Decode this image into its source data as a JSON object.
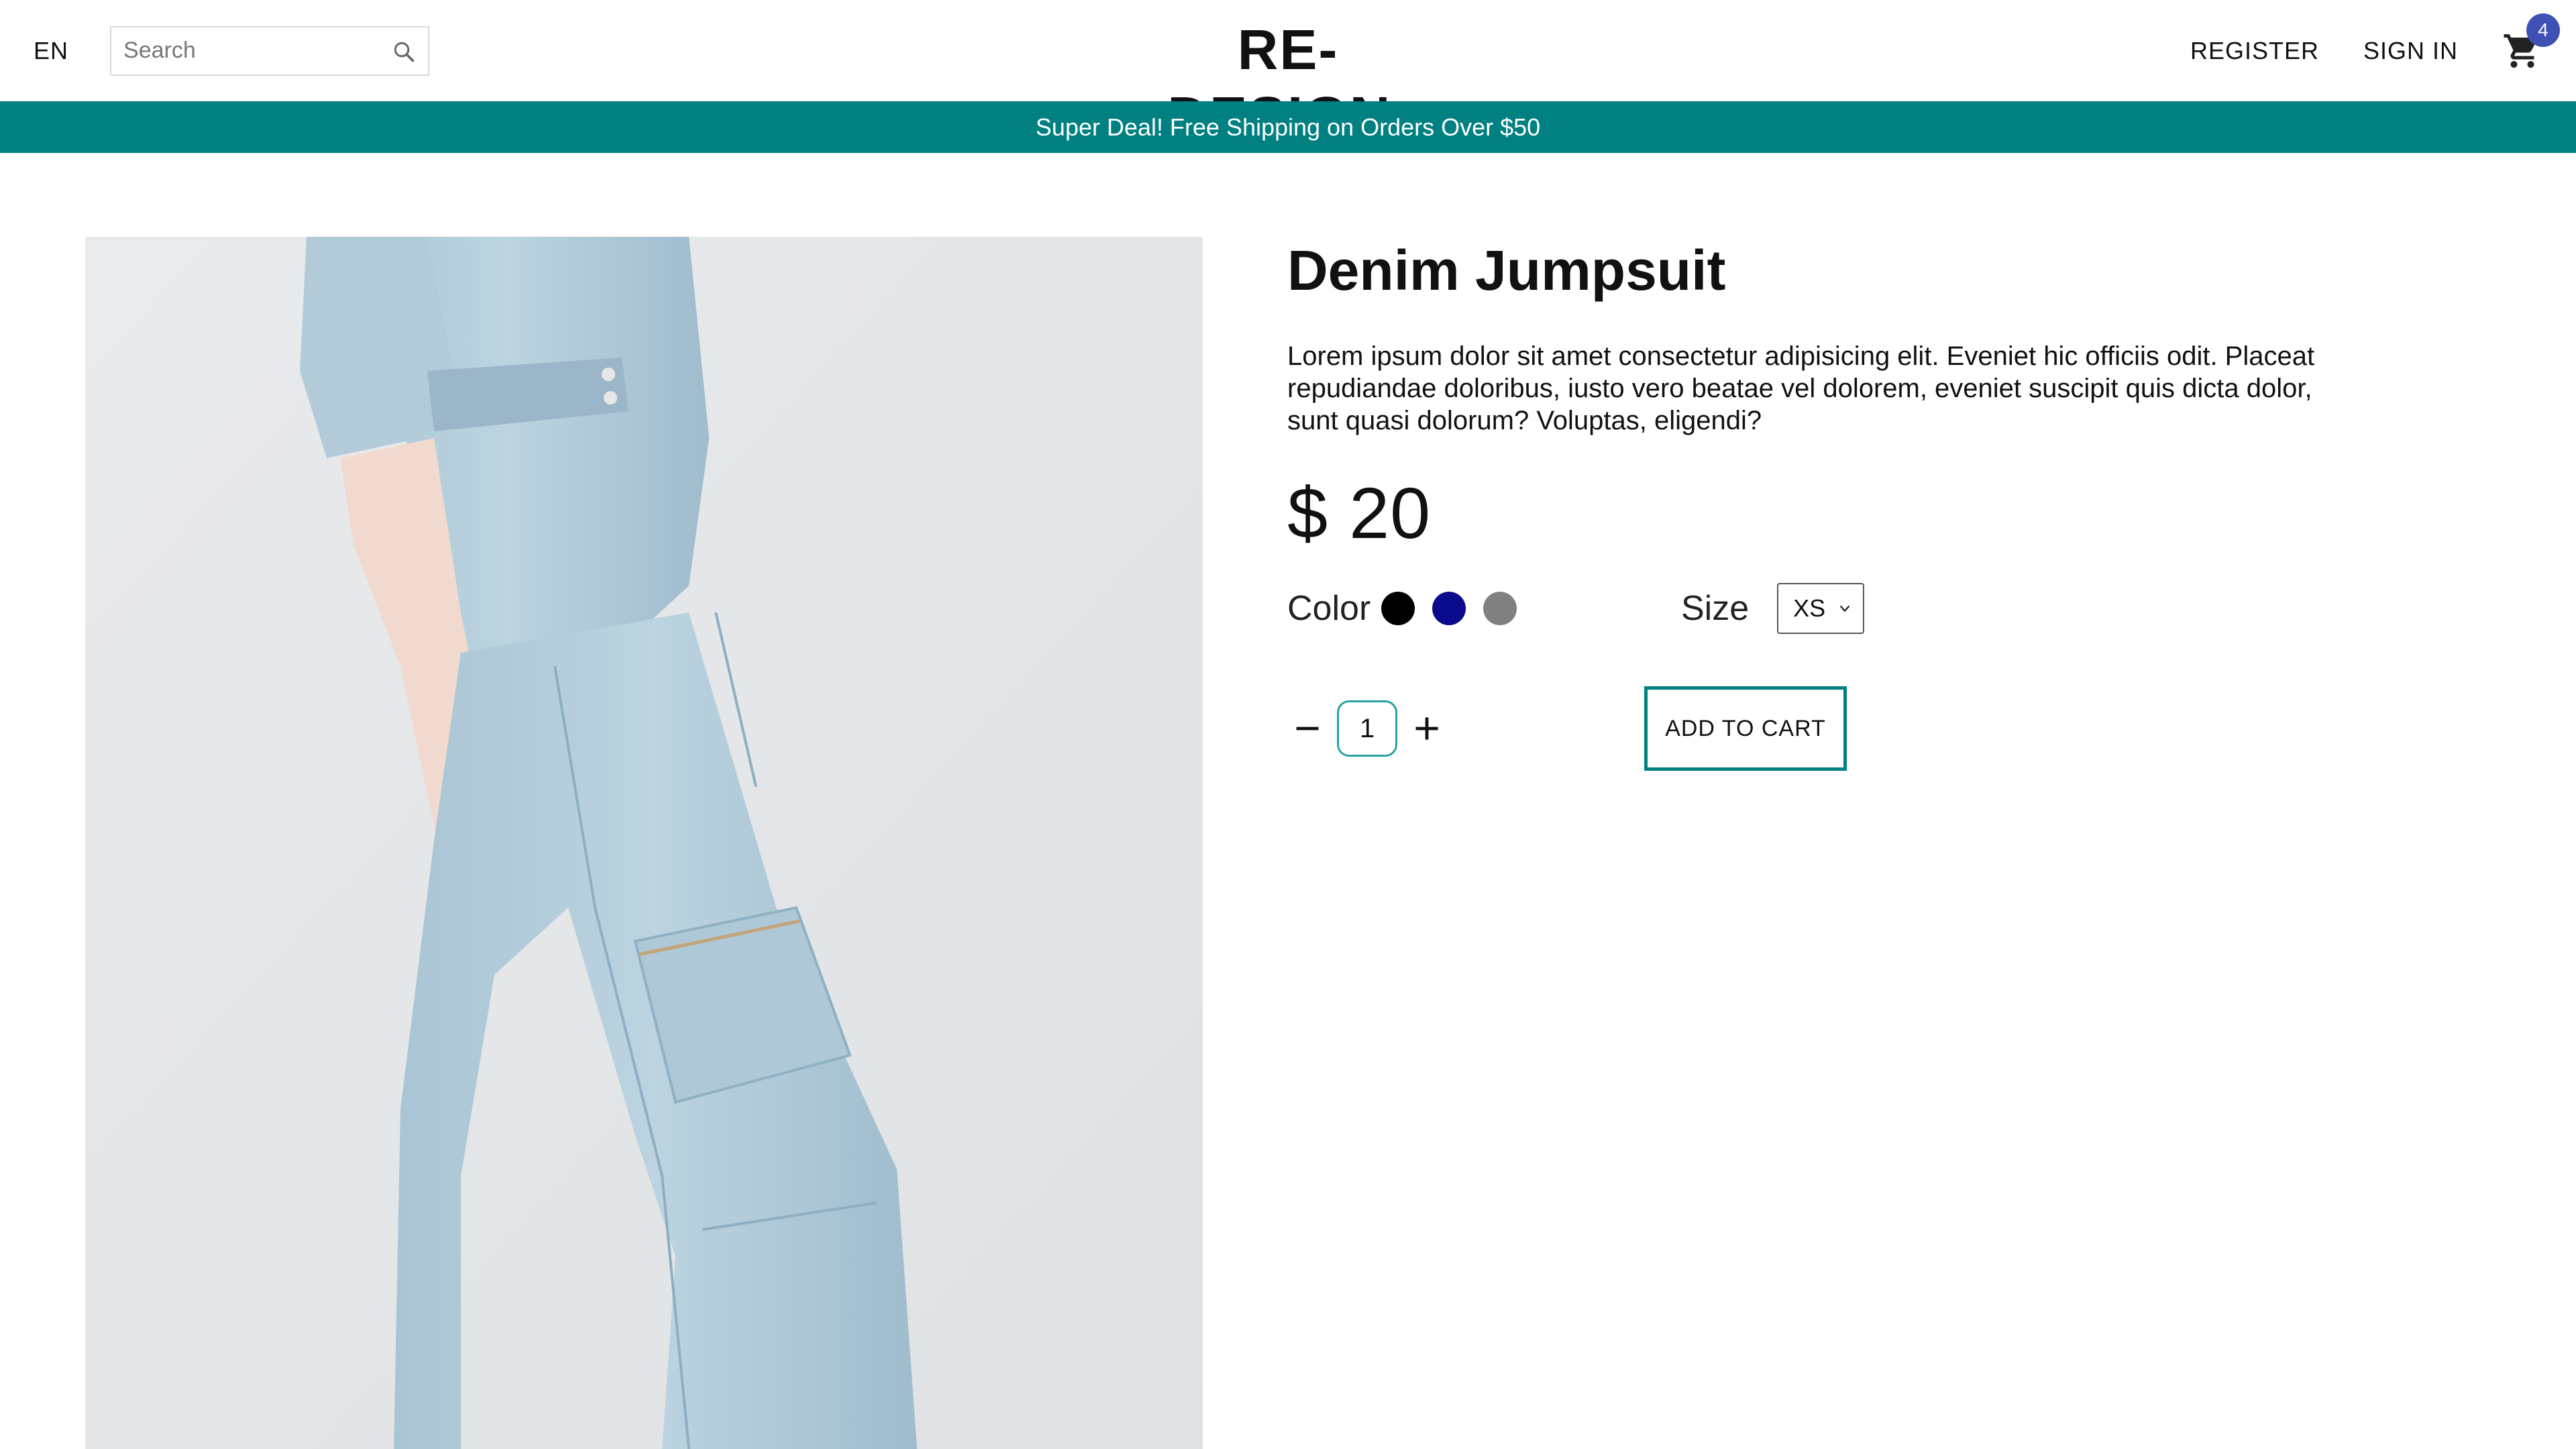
{
  "header": {
    "language": "EN",
    "search_placeholder": "Search",
    "logo": "RE-DESIGN.",
    "register": "REGISTER",
    "sign_in": "SIGN IN",
    "cart_count": "4"
  },
  "promo": {
    "text": "Super Deal! Free Shipping on Orders Over $50"
  },
  "product": {
    "title": "Denim Jumpsuit",
    "description": "Lorem ipsum dolor sit amet consectetur adipisicing elit. Eveniet hic officiis odit. Placeat repudiandae doloribus, iusto vero beatae vel dolorem, eveniet suscipit quis dicta dolor, sunt quasi dolorum? Voluptas, eligendi?",
    "price": "$ 20",
    "color_label": "Color",
    "colors": [
      "#000000",
      "#0a0a8c",
      "#808080"
    ],
    "size_label": "Size",
    "size_selected": "XS",
    "quantity": "1",
    "add_to_cart": "ADD TO CART"
  },
  "theme": {
    "accent": "#008080",
    "badge": "#3f51b5"
  }
}
